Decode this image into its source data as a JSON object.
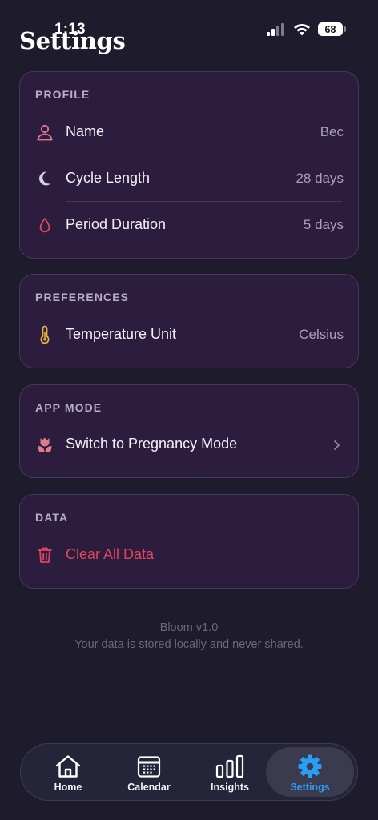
{
  "status_bar": {
    "time": "1:13",
    "battery": "68"
  },
  "header": {
    "title": "Settings"
  },
  "colors": {
    "background": "#1e1b2c",
    "card": "#2c1d3e",
    "accent_pink": "#e07a8f",
    "danger": "#e0455f",
    "warning_yellow": "#e6b23c",
    "tab_active": "#2a9df4"
  },
  "profile": {
    "label": "PROFILE",
    "rows": [
      {
        "icon": "person-icon",
        "label": "Name",
        "value": "Bec"
      },
      {
        "icon": "moon-icon",
        "label": "Cycle Length",
        "value": "28 days"
      },
      {
        "icon": "drop-icon",
        "label": "Period Duration",
        "value": "5 days"
      }
    ]
  },
  "preferences": {
    "label": "PREFERENCES",
    "rows": [
      {
        "icon": "thermometer-icon",
        "label": "Temperature Unit",
        "value": "Celsius"
      }
    ]
  },
  "app_mode": {
    "label": "APP MODE",
    "rows": [
      {
        "icon": "tulip-icon",
        "label": "Switch to Pregnancy Mode"
      }
    ]
  },
  "data_section": {
    "label": "DATA",
    "rows": [
      {
        "icon": "trash-icon",
        "label": "Clear All Data"
      }
    ]
  },
  "about": {
    "version": "Bloom v1.0",
    "privacy": "Your data is stored locally and never shared."
  },
  "tabs": [
    {
      "icon": "home-icon",
      "label": "Home",
      "active": false
    },
    {
      "icon": "calendar-icon",
      "label": "Calendar",
      "active": false
    },
    {
      "icon": "bar-chart-icon",
      "label": "Insights",
      "active": false
    },
    {
      "icon": "gear-icon",
      "label": "Settings",
      "active": true
    }
  ]
}
